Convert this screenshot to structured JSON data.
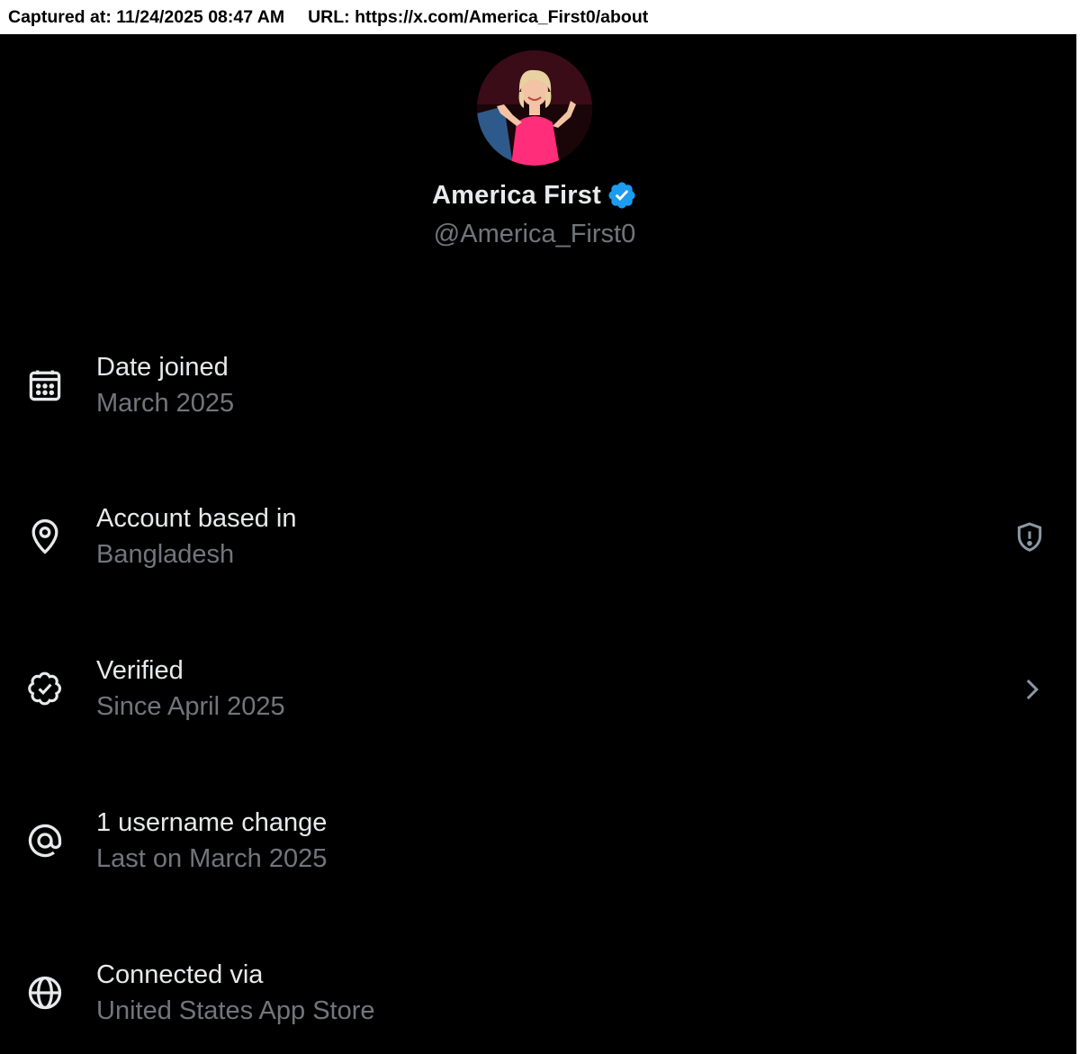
{
  "capture": {
    "captured_at": "Captured at: 11/24/2025 08:47 AM",
    "url": "URL: https://x.com/America_First0/about"
  },
  "profile": {
    "display_name": "America First",
    "handle": "@America_First0",
    "verified_badge_icon": "verified-badge-icon",
    "verified_color": "#1d9bf0"
  },
  "about": {
    "date_joined": {
      "icon": "calendar-icon",
      "title": "Date joined",
      "value": "March 2025"
    },
    "account_based_in": {
      "icon": "location-pin-icon",
      "title": "Account based in",
      "value": "Bangladesh",
      "trailing_icon": "shield-alert-icon"
    },
    "verified": {
      "icon": "verified-outline-icon",
      "title": "Verified",
      "value": "Since April 2025",
      "trailing_icon": "chevron-right-icon"
    },
    "username_changes": {
      "icon": "at-sign-icon",
      "title": "1 username change",
      "value": "Last on March 2025"
    },
    "connected_via": {
      "icon": "globe-icon",
      "title": "Connected via",
      "value": "United States App Store"
    }
  },
  "colors": {
    "background": "#000000",
    "primary_text": "#e7e9ea",
    "secondary_text": "#71767b"
  }
}
